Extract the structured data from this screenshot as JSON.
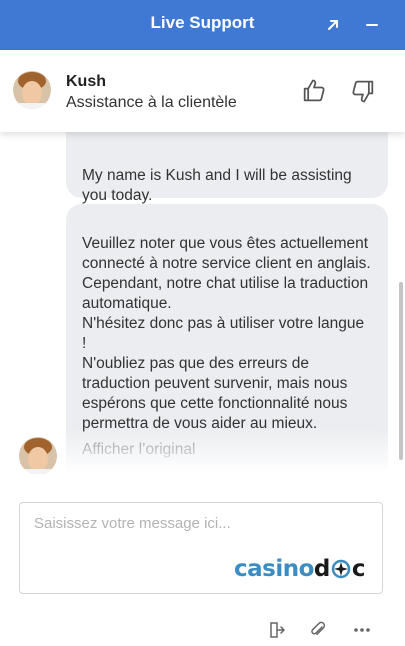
{
  "window": {
    "title": "Live Support"
  },
  "agent": {
    "name": "Kush",
    "role": "Assistance à la clientèle"
  },
  "messages": [
    {
      "text": "My name is Kush and I will be assisting you today."
    },
    {
      "text": "Veuillez noter que vous êtes actuellement connecté à notre service client en anglais. Cependant, notre chat utilise la traduction automatique.\nN'hésitez donc pas à utiliser votre langue !\nN'oubliez pas que des erreurs de traduction peuvent survenir, mais nous espérons que cette fonctionnalité nous permettra de vous aider au mieux.",
      "show_original": "Afficher l’original"
    }
  ],
  "composer": {
    "value": "",
    "placeholder": "Saisissez votre message ici..."
  },
  "brand": {
    "part1": "casino",
    "part2": "d",
    "part3": "c"
  },
  "icons": [
    "expand-icon",
    "minimize-icon",
    "thumbs-up-icon",
    "thumbs-down-icon",
    "exit-icon",
    "paperclip-icon",
    "more-icon"
  ],
  "colors": {
    "header_bg": "#3f79d3",
    "bubble_bg": "#ebedf0",
    "brand_blue": "#3a8cc1"
  }
}
